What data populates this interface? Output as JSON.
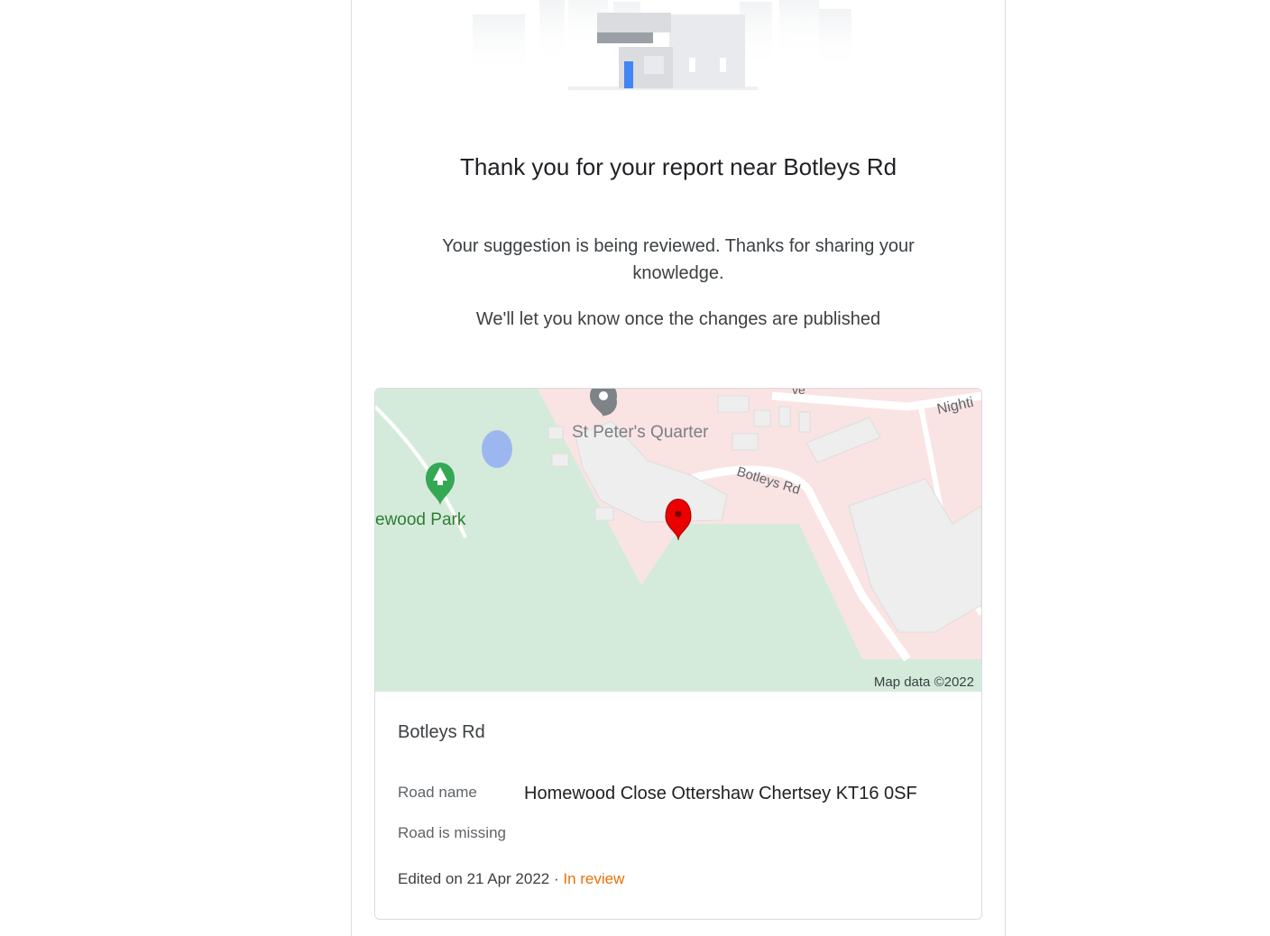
{
  "confirmation": {
    "title": "Thank you for your report near Botleys Rd",
    "message": "Your suggestion is being reviewed. Thanks for sharing your knowledge.",
    "notice": "We'll let you know once the changes are published"
  },
  "edit": {
    "place_name": "Botleys Rd",
    "road_name_label": "Road name",
    "road_name_value": "Homewood Close Ottershaw Chertsey KT16 0SF",
    "issue": "Road is missing",
    "edited_text": "Edited on 21 Apr 2022",
    "separator": " · ",
    "status": "In review"
  },
  "map": {
    "labels": {
      "landmark": "St Peter's Quarter",
      "road": "Botleys Rd",
      "park": "ewood Park",
      "road_top_fragment": "ve",
      "road_right_fragment": "Nighti"
    },
    "attribution": "Map data ©2022",
    "icons": [
      "map-pin-icon",
      "park-tree-icon",
      "place-marker-icon"
    ],
    "colors": {
      "park_green": "#d4ebdb",
      "urban_pink": "#fae3e3",
      "building_gray": "#eeeeee",
      "water_blue": "#9cb7f0",
      "pin_red": "#ea0000",
      "status_orange": "#e8710a"
    }
  }
}
